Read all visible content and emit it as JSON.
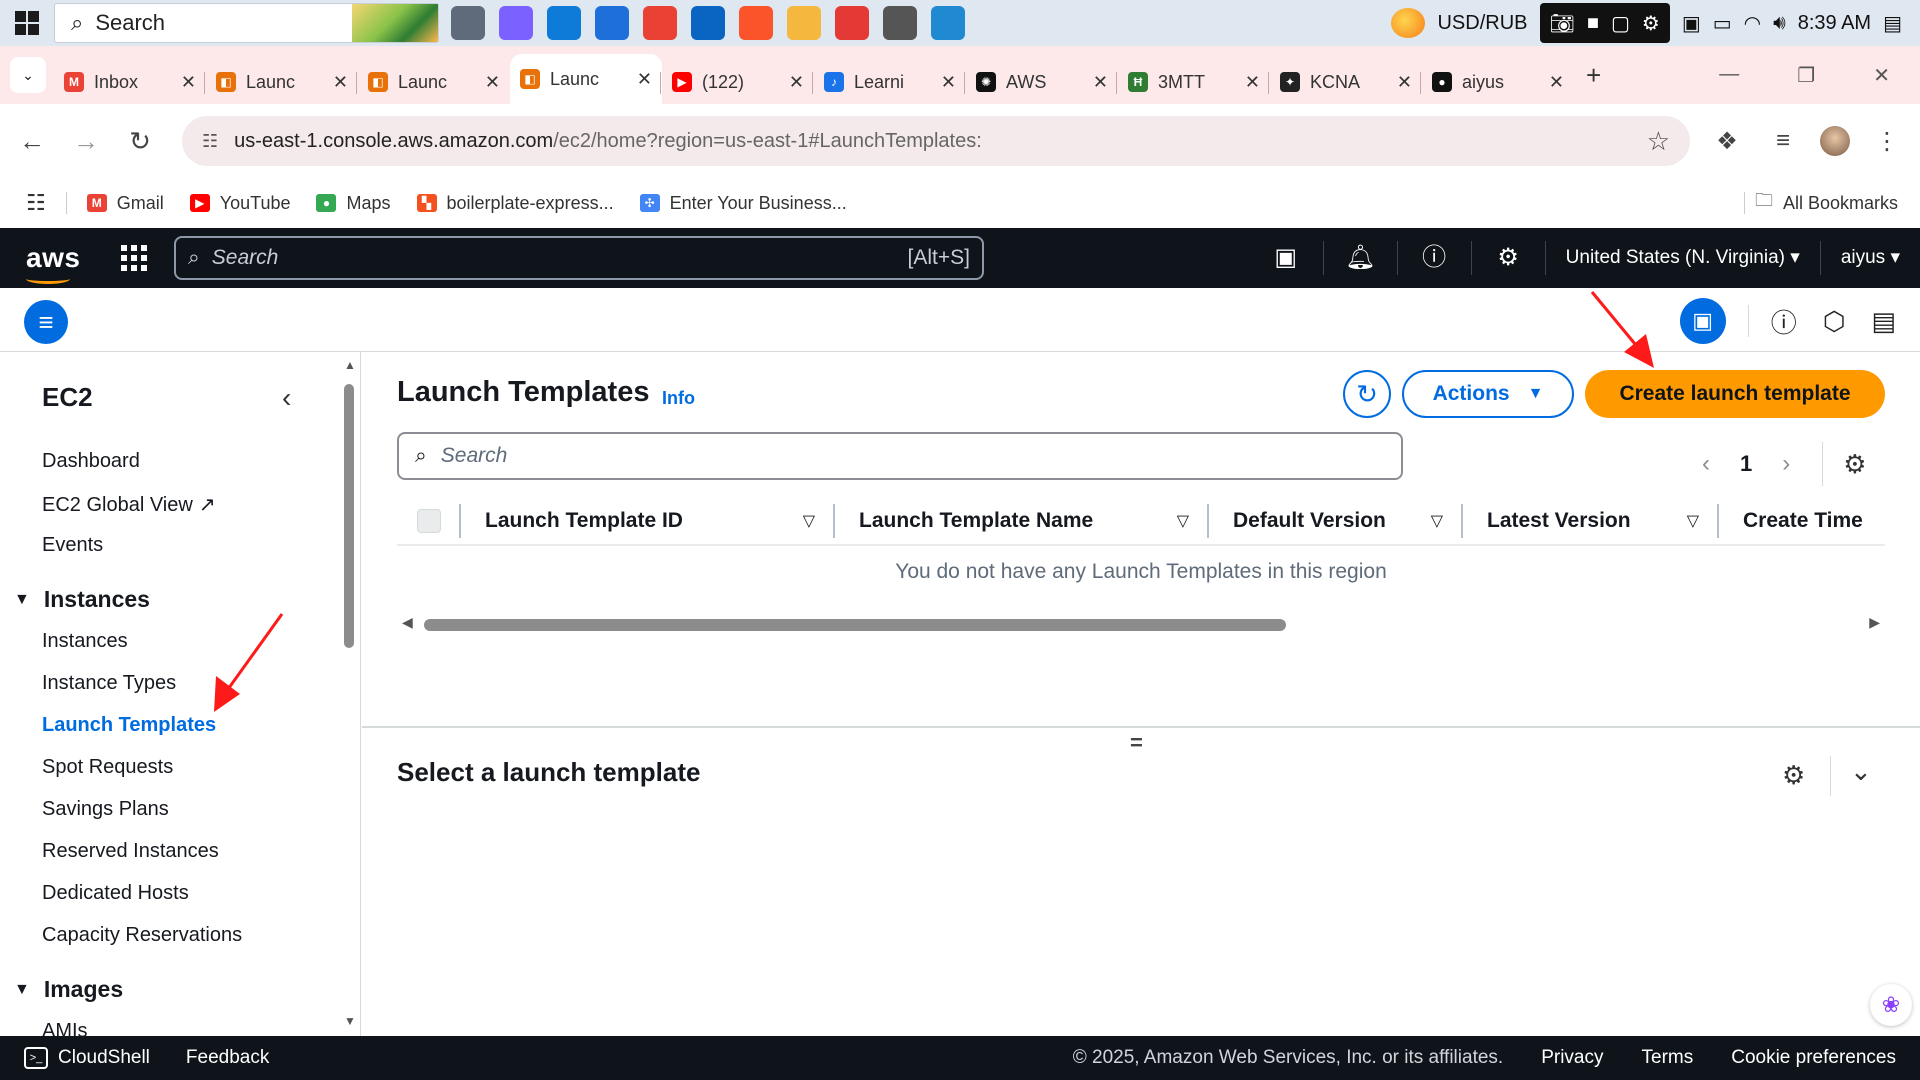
{
  "taskbar": {
    "search_label": "Search",
    "currency_label": "USD/RUB",
    "clock": "8:39 AM",
    "apps": [
      {
        "icon": "task-view-icon",
        "color": "#5f6b7a"
      },
      {
        "icon": "copilot-icon",
        "color": "#7b61ff"
      },
      {
        "icon": "edge-icon",
        "color": "#0f7bd8"
      },
      {
        "icon": "store-icon",
        "color": "#1e6fd9"
      },
      {
        "icon": "chrome-icon",
        "color": "#e94235"
      },
      {
        "icon": "outlook-icon",
        "color": "#0a64c2"
      },
      {
        "icon": "brave-icon",
        "color": "#fb542b"
      },
      {
        "icon": "file-explorer-icon",
        "color": "#f3b83d"
      },
      {
        "icon": "wps-icon",
        "color": "#e53935"
      },
      {
        "icon": "settings-icon",
        "color": "#555555"
      },
      {
        "icon": "vscode-icon",
        "color": "#1f8ad2"
      }
    ]
  },
  "browser": {
    "tabs": [
      {
        "title": "Inbox",
        "favicon": "gmail-icon",
        "color": "#ea4335",
        "letter": "M",
        "active": false
      },
      {
        "title": "Launc",
        "favicon": "aws-icon",
        "color": "#e8710a",
        "letter": "◧",
        "active": false
      },
      {
        "title": "Launc",
        "favicon": "aws-icon",
        "color": "#e8710a",
        "letter": "◧",
        "active": false
      },
      {
        "title": "Launc",
        "favicon": "aws-icon",
        "color": "#e8710a",
        "letter": "◧",
        "active": true
      },
      {
        "title": "(122)",
        "favicon": "youtube-icon",
        "color": "#ff0000",
        "letter": "▶",
        "active": false
      },
      {
        "title": "Learni",
        "favicon": "learn-icon",
        "color": "#1a73e8",
        "letter": "♪",
        "active": false
      },
      {
        "title": "AWS",
        "favicon": "chatgpt-icon",
        "color": "#111111",
        "letter": "✺",
        "active": false
      },
      {
        "title": "3MTT",
        "favicon": "3mtt-icon",
        "color": "#2e7d32",
        "letter": "Ħ",
        "active": false
      },
      {
        "title": "KCNA",
        "favicon": "kcna-icon",
        "color": "#222222",
        "letter": "✦",
        "active": false
      },
      {
        "title": "aiyus",
        "favicon": "github-icon",
        "color": "#111111",
        "letter": "●",
        "active": false
      }
    ],
    "url_domain": "us-east-1.console.aws.amazon.com",
    "url_path": "/ec2/home?region=us-east-1#LaunchTemplates:",
    "bookmarks": [
      {
        "label": "Gmail",
        "icon": "gmail-icon",
        "color": "#ea4335",
        "letter": "M"
      },
      {
        "label": "YouTube",
        "icon": "youtube-icon",
        "color": "#ff0000",
        "letter": "▶"
      },
      {
        "label": "Maps",
        "icon": "maps-icon",
        "color": "#34a853",
        "letter": "●"
      },
      {
        "label": "boilerplate-express...",
        "icon": "boilerplate-icon",
        "color": "#f4511e",
        "letter": "▚"
      },
      {
        "label": "Enter Your Business...",
        "icon": "business-icon",
        "color": "#4285f4",
        "letter": "✣"
      }
    ],
    "all_bookmarks": "All Bookmarks"
  },
  "aws_nav": {
    "logo": "aws",
    "search_placeholder": "Search",
    "search_shortcut": "[Alt+S]",
    "region": "United States (N. Virginia)",
    "user": "aiyus"
  },
  "sidebar": {
    "service": "EC2",
    "top_items": [
      "Dashboard",
      "EC2 Global View",
      "Events"
    ],
    "instances_section": "Instances",
    "instances_items": [
      "Instances",
      "Instance Types",
      "Launch Templates",
      "Spot Requests",
      "Savings Plans",
      "Reserved Instances",
      "Dedicated Hosts",
      "Capacity Reservations"
    ],
    "images_section": "Images",
    "images_items": [
      "AMIs"
    ],
    "active_item": "Launch Templates"
  },
  "main": {
    "title": "Launch Templates",
    "info": "Info",
    "actions": "Actions",
    "create_button": "Create launch template",
    "search_placeholder": "Search",
    "page": "1",
    "columns": [
      "Launch Template ID",
      "Launch Template Name",
      "Default Version",
      "Latest Version",
      "Create Time"
    ],
    "empty_message": "You do not have any Launch Templates in this region",
    "detail_title": "Select a launch template"
  },
  "footer": {
    "cloudshell": "CloudShell",
    "feedback": "Feedback",
    "copyright": "© 2025, Amazon Web Services, Inc. or its affiliates.",
    "privacy": "Privacy",
    "terms": "Terms",
    "cookies": "Cookie preferences"
  },
  "colors": {
    "aws_dark": "#0f141a",
    "aws_link": "#006ce0",
    "aws_orange": "#ff9900",
    "annotation_red": "#ff1a1a"
  }
}
